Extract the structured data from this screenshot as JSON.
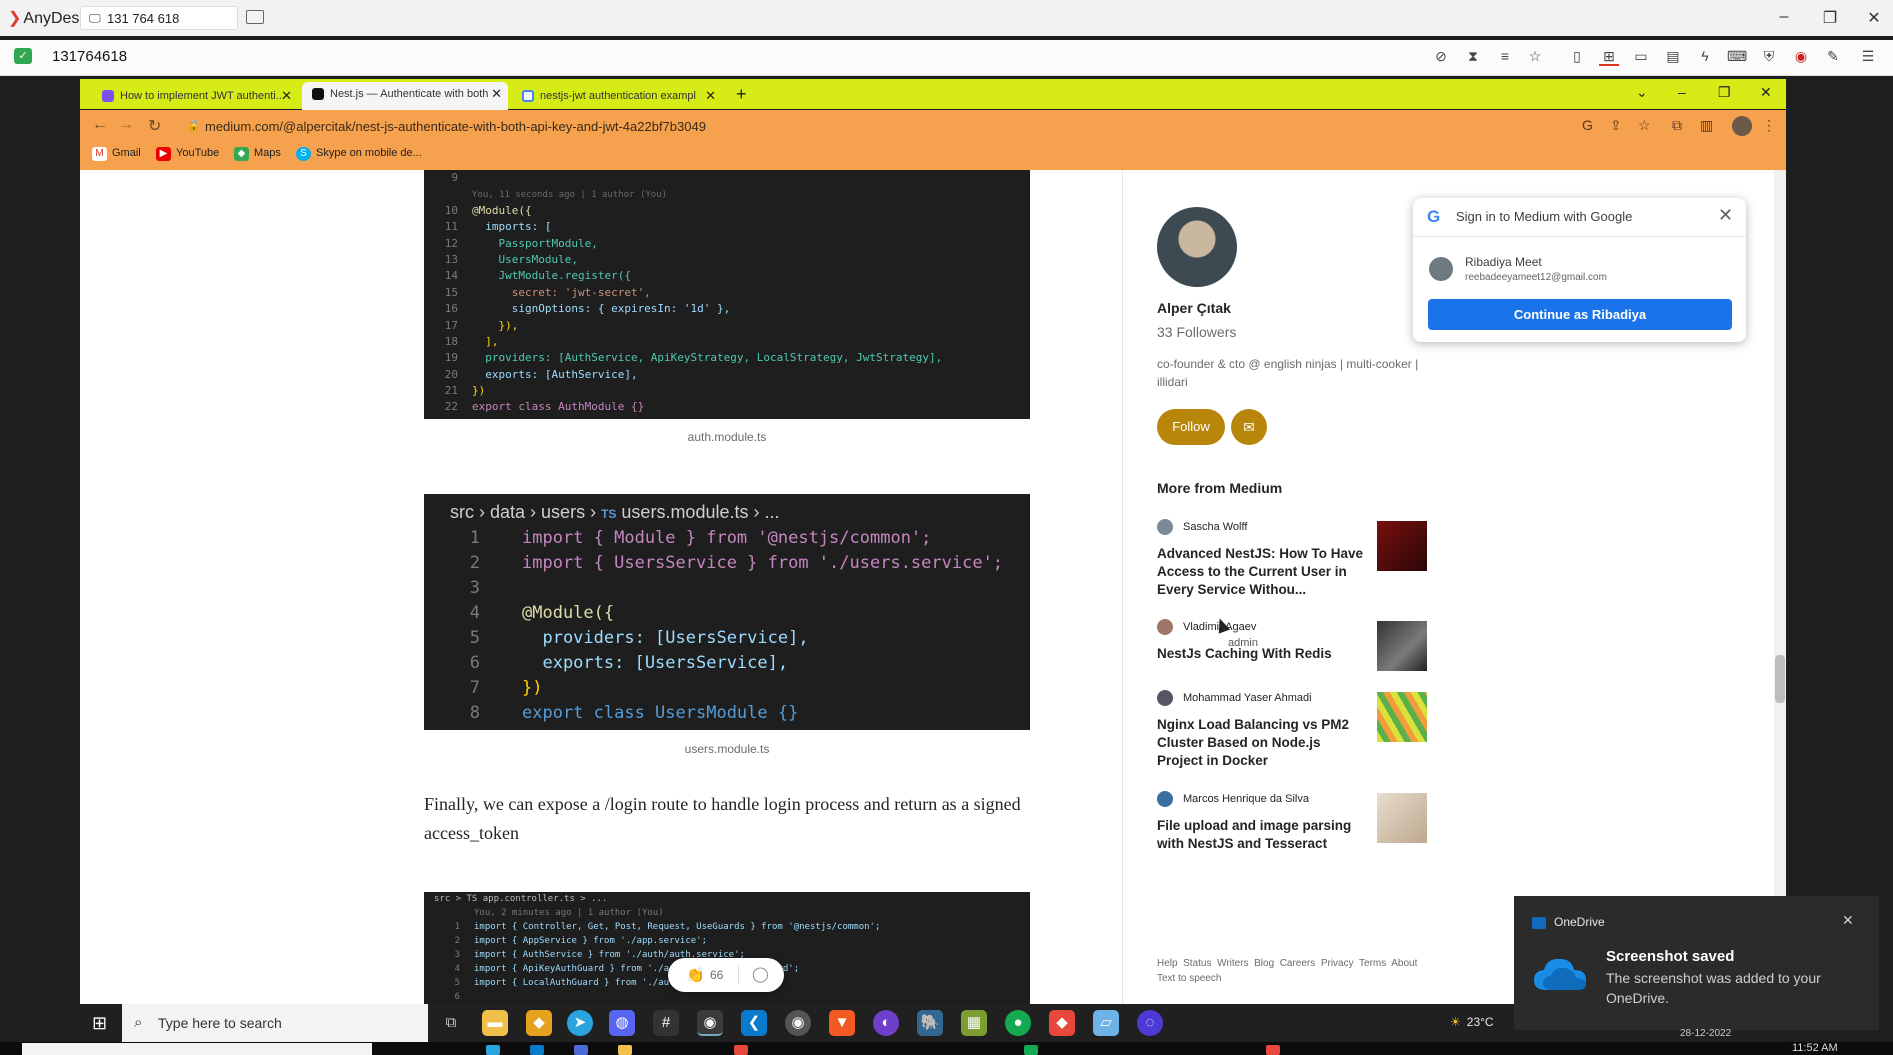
{
  "anydesk": {
    "app_name": "AnyDesk",
    "address": "131 764 618",
    "session_id": "131764618"
  },
  "browser": {
    "tabs": [
      {
        "label": "How to implement JWT authenti...",
        "active": false
      },
      {
        "label": "Nest.js — Authenticate with both",
        "active": true
      },
      {
        "label": "nestjs-jwt authentication exampl",
        "active": false
      }
    ],
    "url": "medium.com/@alpercitak/nest-js-authenticate-with-both-api-key-and-jwt-4a22bf7b3049",
    "bookmarks": [
      "Gmail",
      "YouTube",
      "Maps",
      "Skype on mobile de..."
    ]
  },
  "article": {
    "code1_blame": "You, 11 seconds ago | 1 author (You)",
    "code1_lines": [
      {
        "n": "9",
        "text": ""
      },
      {
        "n": "10",
        "text": "@Module({"
      },
      {
        "n": "11",
        "text": "  imports: ["
      },
      {
        "n": "12",
        "text": "    PassportModule,"
      },
      {
        "n": "13",
        "text": "    UsersModule,"
      },
      {
        "n": "14",
        "text": "    JwtModule.register({"
      },
      {
        "n": "15",
        "text": "      secret: 'jwt-secret',"
      },
      {
        "n": "16",
        "text": "      signOptions: { expiresIn: '1d' },"
      },
      {
        "n": "17",
        "text": "    }),"
      },
      {
        "n": "18",
        "text": "  ],"
      },
      {
        "n": "19",
        "text": "  providers: [AuthService, ApiKeyStrategy, LocalStrategy, JwtStrategy],"
      },
      {
        "n": "20",
        "text": "  exports: [AuthService],"
      },
      {
        "n": "21",
        "text": "})"
      },
      {
        "n": "22",
        "text": "export class AuthModule {}"
      }
    ],
    "caption1": "auth.module.ts",
    "code2_breadcrumb": [
      "src",
      "data",
      "users",
      "TS",
      "users.module.ts",
      "..."
    ],
    "code2_lines": [
      {
        "n": "1",
        "text": "import { Module } from '@nestjs/common';"
      },
      {
        "n": "2",
        "text": "import { UsersService } from './users.service';"
      },
      {
        "n": "3",
        "text": ""
      },
      {
        "n": "4",
        "text": "@Module({"
      },
      {
        "n": "5",
        "text": "  providers: [UsersService],"
      },
      {
        "n": "6",
        "text": "  exports: [UsersService],"
      },
      {
        "n": "7",
        "text": "})"
      },
      {
        "n": "8",
        "text": "export class UsersModule {}"
      }
    ],
    "caption2": "users.module.ts",
    "paragraph": "Finally, we can expose a /login route to handle login process and return as a signed access_token",
    "code3_breadcrumb": "src > TS app.controller.ts > ...",
    "code3_blame": "You, 2 minutes ago | 1 author (You)",
    "code3_lines": [
      {
        "n": "1",
        "text": "import { Controller, Get, Post, Request, UseGuards } from '@nestjs/common';"
      },
      {
        "n": "2",
        "text": "import { AppService } from './app.service';"
      },
      {
        "n": "3",
        "text": "import { AuthService } from './auth/auth.service';"
      },
      {
        "n": "4",
        "text": "import { ApiKeyAuthGuard } from './auth/api-key-auth.guard';"
      },
      {
        "n": "5",
        "text": "import { LocalAuthGuard } from './auth/local-auth.guard';"
      },
      {
        "n": "6",
        "text": ""
      }
    ],
    "clap_count": "66"
  },
  "sidebar": {
    "author_name": "Alper Çıtak",
    "followers": "33 Followers",
    "bio": "co-founder & cto @ english ninjas | multi-cooker | illidari",
    "follow_label": "Follow",
    "more_title": "More from Medium",
    "recommendations": [
      {
        "author": "Sascha Wolff",
        "title": "Advanced NestJS: How To Have Access to the Current User in Every Service Withou..."
      },
      {
        "author": "Vladimir Agaev",
        "title": "NestJs Caching With Redis"
      },
      {
        "author": "Mohammad Yaser Ahmadi",
        "title": "Nginx Load Balancing vs PM2 Cluster Based on Node.js Project in Docker"
      },
      {
        "author": "Marcos Henrique da Silva",
        "title": "File upload and image parsing with NestJS and Tesseract"
      }
    ],
    "footer_links": [
      "Help",
      "Status",
      "Writers",
      "Blog",
      "Careers",
      "Privacy",
      "Terms",
      "About",
      "Text to speech"
    ]
  },
  "google_signin": {
    "title": "Sign in to Medium with Google",
    "account_name": "Ribadiya Meet",
    "account_email": "reebadeeyameet12@gmail.com",
    "cta": "Continue as Ribadiya"
  },
  "cursor_label": "admin",
  "toast": {
    "app": "OneDrive",
    "title": "Screenshot saved",
    "body": "The screenshot was added to your OneDrive."
  },
  "taskbar": {
    "search_placeholder": "Type here to search",
    "weather": "23°C",
    "date": "28-12-2022",
    "time": "11:52 AM"
  }
}
